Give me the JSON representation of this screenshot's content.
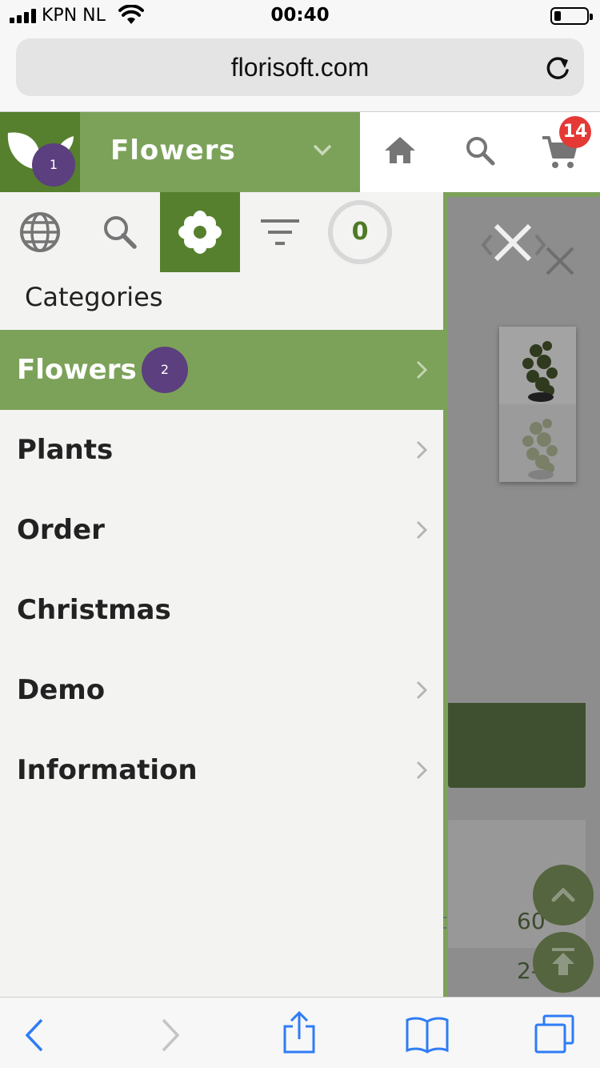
{
  "status_bar": {
    "carrier": "KPN NL",
    "time": "00:40",
    "battery_level": 0.2
  },
  "browser": {
    "url": "florisoft.com",
    "reload_icon": "reload-icon"
  },
  "header": {
    "category_label": "Flowers",
    "cart_count": "14",
    "icons": [
      "leaf-logo-icon",
      "chevron-down-icon",
      "home-icon",
      "search-icon",
      "cart-icon"
    ]
  },
  "tour_steps": {
    "step1": "1",
    "step2": "2"
  },
  "sidebar": {
    "tabs": [
      "globe-icon",
      "search-icon",
      "flower-icon",
      "filter-icon"
    ],
    "active_tab": "flower-icon",
    "counter": "0",
    "section_title": "Categories",
    "items": [
      {
        "label": "Flowers",
        "has_chevron": true,
        "active": true
      },
      {
        "label": "Plants",
        "has_chevron": true,
        "active": false
      },
      {
        "label": "Order",
        "has_chevron": true,
        "active": false
      },
      {
        "label": "Christmas",
        "has_chevron": false,
        "active": false
      },
      {
        "label": "Demo",
        "has_chevron": true,
        "active": false
      },
      {
        "label": "Information",
        "has_chevron": true,
        "active": false
      }
    ]
  },
  "background": {
    "value_1": "60",
    "value_2": "2-3",
    "partial_text": "t"
  },
  "toolbar": {
    "icons": [
      "back-icon",
      "forward-icon",
      "share-icon",
      "bookmarks-icon",
      "tabs-icon"
    ]
  },
  "colors": {
    "brand_dark": "#56802e",
    "brand_light": "#7ca25a",
    "badge_red": "#e53935",
    "tour_purple": "#5b3f7e",
    "ios_blue": "#2f7cf6"
  }
}
